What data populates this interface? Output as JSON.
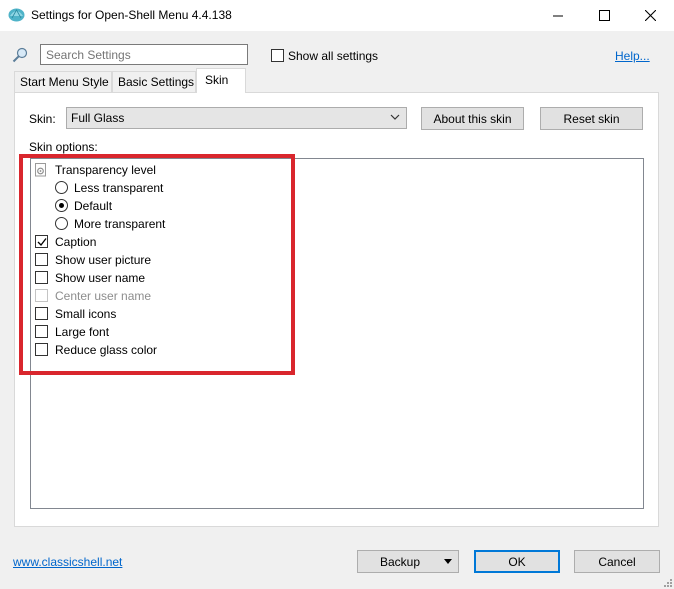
{
  "window": {
    "title": "Settings for Open-Shell Menu 4.4.138"
  },
  "colors": {
    "accent": "#0078d7",
    "highlight": "#d9262d",
    "link": "#0066cc"
  },
  "toolbar": {
    "search_placeholder": "Search Settings",
    "show_all_label": "Show all settings",
    "show_all_checked": false,
    "help_label": "Help..."
  },
  "tabs": [
    {
      "label": "Start Menu Style",
      "active": false
    },
    {
      "label": "Basic Settings",
      "active": false
    },
    {
      "label": "Skin",
      "active": true
    }
  ],
  "skin": {
    "label": "Skin:",
    "selected": "Full Glass",
    "about_button": "About this skin",
    "reset_button": "Reset skin",
    "options_label": "Skin options:"
  },
  "options": {
    "transparency_label": "Transparency level",
    "radios": [
      {
        "label": "Less transparent",
        "checked": false
      },
      {
        "label": "Default",
        "checked": true
      },
      {
        "label": "More transparent",
        "checked": false
      }
    ],
    "checkboxes": [
      {
        "label": "Caption",
        "checked": true,
        "enabled": true
      },
      {
        "label": "Show user picture",
        "checked": false,
        "enabled": true
      },
      {
        "label": "Show user name",
        "checked": false,
        "enabled": true
      },
      {
        "label": "Center user name",
        "checked": false,
        "enabled": false
      },
      {
        "label": "Small icons",
        "checked": false,
        "enabled": true
      },
      {
        "label": "Large font",
        "checked": false,
        "enabled": true
      },
      {
        "label": "Reduce glass color",
        "checked": false,
        "enabled": true
      }
    ]
  },
  "footer": {
    "site_link": "www.classicshell.net",
    "backup_label": "Backup",
    "ok_label": "OK",
    "cancel_label": "Cancel"
  }
}
